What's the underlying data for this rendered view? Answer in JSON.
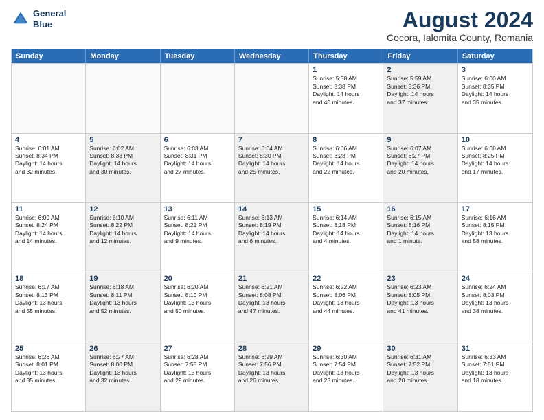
{
  "header": {
    "logo_line1": "General",
    "logo_line2": "Blue",
    "main_title": "August 2024",
    "subtitle": "Cocora, Ialomita County, Romania"
  },
  "days_of_week": [
    "Sunday",
    "Monday",
    "Tuesday",
    "Wednesday",
    "Thursday",
    "Friday",
    "Saturday"
  ],
  "rows": [
    [
      {
        "day": "",
        "info": [],
        "empty": true
      },
      {
        "day": "",
        "info": [],
        "empty": true
      },
      {
        "day": "",
        "info": [],
        "empty": true
      },
      {
        "day": "",
        "info": [],
        "empty": true
      },
      {
        "day": "1",
        "info": [
          "Sunrise: 5:58 AM",
          "Sunset: 8:38 PM",
          "Daylight: 14 hours",
          "and 40 minutes."
        ],
        "empty": false,
        "shaded": false
      },
      {
        "day": "2",
        "info": [
          "Sunrise: 5:59 AM",
          "Sunset: 8:36 PM",
          "Daylight: 14 hours",
          "and 37 minutes."
        ],
        "empty": false,
        "shaded": true
      },
      {
        "day": "3",
        "info": [
          "Sunrise: 6:00 AM",
          "Sunset: 8:35 PM",
          "Daylight: 14 hours",
          "and 35 minutes."
        ],
        "empty": false,
        "shaded": false
      }
    ],
    [
      {
        "day": "4",
        "info": [
          "Sunrise: 6:01 AM",
          "Sunset: 8:34 PM",
          "Daylight: 14 hours",
          "and 32 minutes."
        ],
        "empty": false,
        "shaded": false
      },
      {
        "day": "5",
        "info": [
          "Sunrise: 6:02 AM",
          "Sunset: 8:33 PM",
          "Daylight: 14 hours",
          "and 30 minutes."
        ],
        "empty": false,
        "shaded": true
      },
      {
        "day": "6",
        "info": [
          "Sunrise: 6:03 AM",
          "Sunset: 8:31 PM",
          "Daylight: 14 hours",
          "and 27 minutes."
        ],
        "empty": false,
        "shaded": false
      },
      {
        "day": "7",
        "info": [
          "Sunrise: 6:04 AM",
          "Sunset: 8:30 PM",
          "Daylight: 14 hours",
          "and 25 minutes."
        ],
        "empty": false,
        "shaded": true
      },
      {
        "day": "8",
        "info": [
          "Sunrise: 6:06 AM",
          "Sunset: 8:28 PM",
          "Daylight: 14 hours",
          "and 22 minutes."
        ],
        "empty": false,
        "shaded": false
      },
      {
        "day": "9",
        "info": [
          "Sunrise: 6:07 AM",
          "Sunset: 8:27 PM",
          "Daylight: 14 hours",
          "and 20 minutes."
        ],
        "empty": false,
        "shaded": true
      },
      {
        "day": "10",
        "info": [
          "Sunrise: 6:08 AM",
          "Sunset: 8:25 PM",
          "Daylight: 14 hours",
          "and 17 minutes."
        ],
        "empty": false,
        "shaded": false
      }
    ],
    [
      {
        "day": "11",
        "info": [
          "Sunrise: 6:09 AM",
          "Sunset: 8:24 PM",
          "Daylight: 14 hours",
          "and 14 minutes."
        ],
        "empty": false,
        "shaded": false
      },
      {
        "day": "12",
        "info": [
          "Sunrise: 6:10 AM",
          "Sunset: 8:22 PM",
          "Daylight: 14 hours",
          "and 12 minutes."
        ],
        "empty": false,
        "shaded": true
      },
      {
        "day": "13",
        "info": [
          "Sunrise: 6:11 AM",
          "Sunset: 8:21 PM",
          "Daylight: 14 hours",
          "and 9 minutes."
        ],
        "empty": false,
        "shaded": false
      },
      {
        "day": "14",
        "info": [
          "Sunrise: 6:13 AM",
          "Sunset: 8:19 PM",
          "Daylight: 14 hours",
          "and 6 minutes."
        ],
        "empty": false,
        "shaded": true
      },
      {
        "day": "15",
        "info": [
          "Sunrise: 6:14 AM",
          "Sunset: 8:18 PM",
          "Daylight: 14 hours",
          "and 4 minutes."
        ],
        "empty": false,
        "shaded": false
      },
      {
        "day": "16",
        "info": [
          "Sunrise: 6:15 AM",
          "Sunset: 8:16 PM",
          "Daylight: 14 hours",
          "and 1 minute."
        ],
        "empty": false,
        "shaded": true
      },
      {
        "day": "17",
        "info": [
          "Sunrise: 6:16 AM",
          "Sunset: 8:15 PM",
          "Daylight: 13 hours",
          "and 58 minutes."
        ],
        "empty": false,
        "shaded": false
      }
    ],
    [
      {
        "day": "18",
        "info": [
          "Sunrise: 6:17 AM",
          "Sunset: 8:13 PM",
          "Daylight: 13 hours",
          "and 55 minutes."
        ],
        "empty": false,
        "shaded": false
      },
      {
        "day": "19",
        "info": [
          "Sunrise: 6:18 AM",
          "Sunset: 8:11 PM",
          "Daylight: 13 hours",
          "and 52 minutes."
        ],
        "empty": false,
        "shaded": true
      },
      {
        "day": "20",
        "info": [
          "Sunrise: 6:20 AM",
          "Sunset: 8:10 PM",
          "Daylight: 13 hours",
          "and 50 minutes."
        ],
        "empty": false,
        "shaded": false
      },
      {
        "day": "21",
        "info": [
          "Sunrise: 6:21 AM",
          "Sunset: 8:08 PM",
          "Daylight: 13 hours",
          "and 47 minutes."
        ],
        "empty": false,
        "shaded": true
      },
      {
        "day": "22",
        "info": [
          "Sunrise: 6:22 AM",
          "Sunset: 8:06 PM",
          "Daylight: 13 hours",
          "and 44 minutes."
        ],
        "empty": false,
        "shaded": false
      },
      {
        "day": "23",
        "info": [
          "Sunrise: 6:23 AM",
          "Sunset: 8:05 PM",
          "Daylight: 13 hours",
          "and 41 minutes."
        ],
        "empty": false,
        "shaded": true
      },
      {
        "day": "24",
        "info": [
          "Sunrise: 6:24 AM",
          "Sunset: 8:03 PM",
          "Daylight: 13 hours",
          "and 38 minutes."
        ],
        "empty": false,
        "shaded": false
      }
    ],
    [
      {
        "day": "25",
        "info": [
          "Sunrise: 6:26 AM",
          "Sunset: 8:01 PM",
          "Daylight: 13 hours",
          "and 35 minutes."
        ],
        "empty": false,
        "shaded": false
      },
      {
        "day": "26",
        "info": [
          "Sunrise: 6:27 AM",
          "Sunset: 8:00 PM",
          "Daylight: 13 hours",
          "and 32 minutes."
        ],
        "empty": false,
        "shaded": true
      },
      {
        "day": "27",
        "info": [
          "Sunrise: 6:28 AM",
          "Sunset: 7:58 PM",
          "Daylight: 13 hours",
          "and 29 minutes."
        ],
        "empty": false,
        "shaded": false
      },
      {
        "day": "28",
        "info": [
          "Sunrise: 6:29 AM",
          "Sunset: 7:56 PM",
          "Daylight: 13 hours",
          "and 26 minutes."
        ],
        "empty": false,
        "shaded": true
      },
      {
        "day": "29",
        "info": [
          "Sunrise: 6:30 AM",
          "Sunset: 7:54 PM",
          "Daylight: 13 hours",
          "and 23 minutes."
        ],
        "empty": false,
        "shaded": false
      },
      {
        "day": "30",
        "info": [
          "Sunrise: 6:31 AM",
          "Sunset: 7:52 PM",
          "Daylight: 13 hours",
          "and 20 minutes."
        ],
        "empty": false,
        "shaded": true
      },
      {
        "day": "31",
        "info": [
          "Sunrise: 6:33 AM",
          "Sunset: 7:51 PM",
          "Daylight: 13 hours",
          "and 18 minutes."
        ],
        "empty": false,
        "shaded": false
      }
    ]
  ]
}
